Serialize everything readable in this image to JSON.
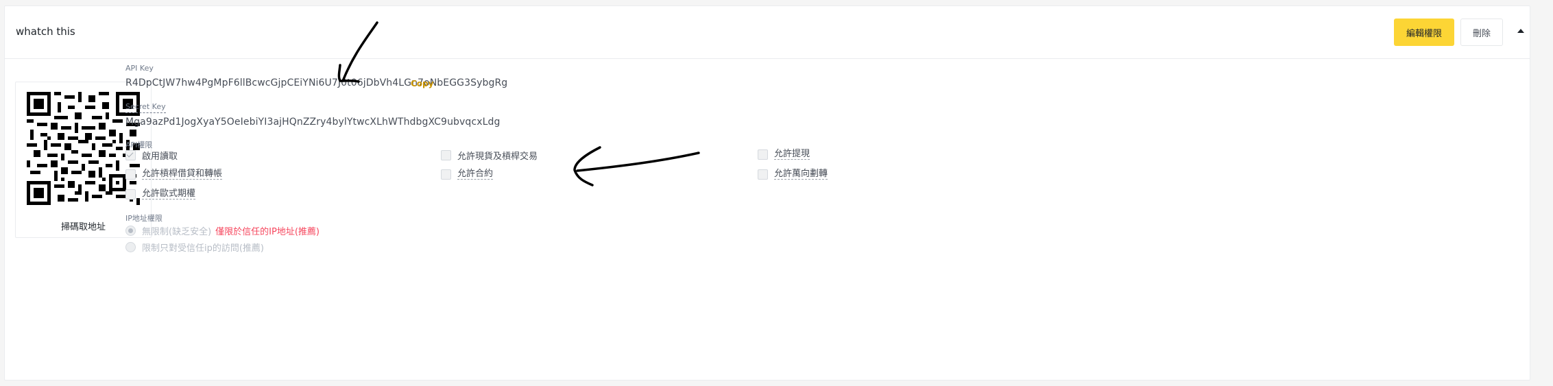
{
  "header": {
    "api_name": "whatch this",
    "edit_button": "編輯權限",
    "delete_button": "刪除"
  },
  "qr": {
    "caption": "掃碼取地址"
  },
  "api_key": {
    "label": "API Key",
    "value": "R4DpCtJW7hw4PgMpF6llBcwcGjpCEiYNi6U7J0t06jDbVh4LGn7oNbEGG3SybgRg",
    "copy_label": "Copy"
  },
  "secret_key": {
    "label": "Secret Key",
    "value": "Mga9azPd1JogXyaY5OeIebiYI3ajHQnZZry4bylYtwcXLhWThdbgXC9ubvqcxLdg"
  },
  "permissions": {
    "title": "API權限",
    "items": [
      {
        "label": "啟用讀取",
        "checked": true
      },
      {
        "label": "允許現貨及槓桿交易",
        "checked": false
      },
      {
        "label": "允許提現",
        "checked": false
      },
      {
        "label": "允許槓桿借貸和轉帳",
        "checked": false
      },
      {
        "label": "允許合約",
        "checked": false
      },
      {
        "label": "允許萬向劃轉",
        "checked": false
      },
      {
        "label": "允許歐式期權",
        "checked": false
      }
    ]
  },
  "ip": {
    "title": "IP地址權限",
    "option_unrestricted": "無限制(缺乏安全)",
    "warning": "僅限於信任的IP地址(推薦)",
    "option_restricted": "限制只對受信任ip的訪問(推薦)"
  },
  "colors": {
    "accent": "#fcd535",
    "copy": "#c99400",
    "warning": "#f6465d"
  },
  "icons": [
    "qr-code-icon",
    "caret-up-icon",
    "check-icon"
  ]
}
